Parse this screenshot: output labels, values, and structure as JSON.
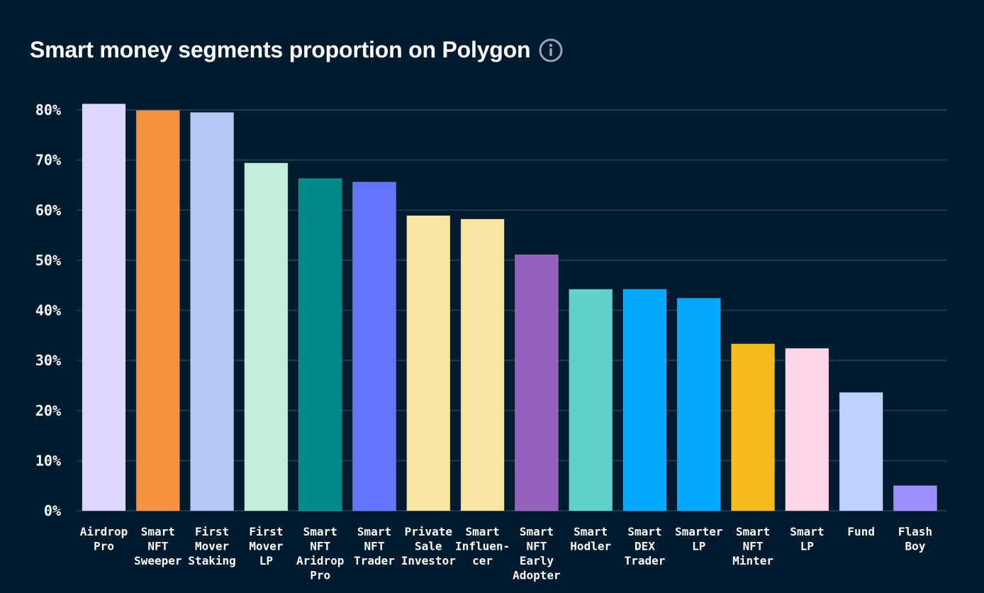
{
  "header": {
    "title": "Smart money segments proportion on Polygon",
    "info_icon": "info-circle-icon"
  },
  "colors": {
    "background": "#001a2e",
    "gridline": "#1d3a52",
    "text": "#ffffff",
    "icon": "#9aa4b0"
  },
  "chart_data": {
    "type": "bar",
    "title": "Smart money segments proportion on Polygon",
    "xlabel": "",
    "ylabel": "",
    "ylim": [
      0,
      80
    ],
    "yticks": [
      0,
      10,
      20,
      30,
      40,
      50,
      60,
      70,
      80
    ],
    "ytick_labels": [
      "0%",
      "10%",
      "20%",
      "30%",
      "40%",
      "50%",
      "60%",
      "70%",
      "80%"
    ],
    "grid": true,
    "legend": "none",
    "unit": "%",
    "categories": [
      "Airdrop Pro",
      "Smart NFT Sweeper",
      "First Mover Staking",
      "First Mover LP",
      "Smart NFT Aridrop Pro",
      "Smart NFT Trader",
      "Private Sale Investor",
      "Smart Influencer",
      "Smart NFT Early Adopter",
      "Smart Hodler",
      "Smart DEX Trader",
      "Smarter LP",
      "Smart NFT Minter",
      "Smart LP",
      "Fund",
      "Flash Boy"
    ],
    "category_label_lines": [
      [
        "Airdrop",
        "Pro"
      ],
      [
        "Smart",
        "NFT",
        "Sweeper"
      ],
      [
        "First",
        "Mover",
        "Staking"
      ],
      [
        "First",
        "Mover",
        "LP"
      ],
      [
        "Smart",
        "NFT",
        "Aridrop",
        "Pro"
      ],
      [
        "Smart",
        "NFT",
        "Trader"
      ],
      [
        "Private",
        "Sale",
        "Investor"
      ],
      [
        "Smart",
        "Influen-",
        "cer"
      ],
      [
        "Smart",
        "NFT",
        "Early",
        "Adopter"
      ],
      [
        "Smart",
        "Hodler"
      ],
      [
        "Smart",
        "DEX",
        "Trader"
      ],
      [
        "Smarter",
        "LP"
      ],
      [
        "Smart",
        "NFT",
        "Minter"
      ],
      [
        "Smart",
        "LP"
      ],
      [
        "Fund"
      ],
      [
        "Flash",
        "Boy"
      ]
    ],
    "values": [
      81.2,
      79.9,
      79.5,
      69.4,
      66.3,
      65.6,
      58.9,
      58.2,
      51.1,
      44.2,
      44.2,
      42.4,
      33.3,
      32.4,
      23.6,
      5.0
    ],
    "bar_colors": [
      "#dcd6ff",
      "#f7923f",
      "#b3c7f0",
      "#c1eedb",
      "#03898a",
      "#6275ff",
      "#f9e4a0",
      "#f9e4a0",
      "#9960bd",
      "#5cd2c8",
      "#03a8ff",
      "#03a8ff",
      "#f6bb1a",
      "#ffd6e7",
      "#bfd2ff",
      "#9c8eff"
    ]
  }
}
